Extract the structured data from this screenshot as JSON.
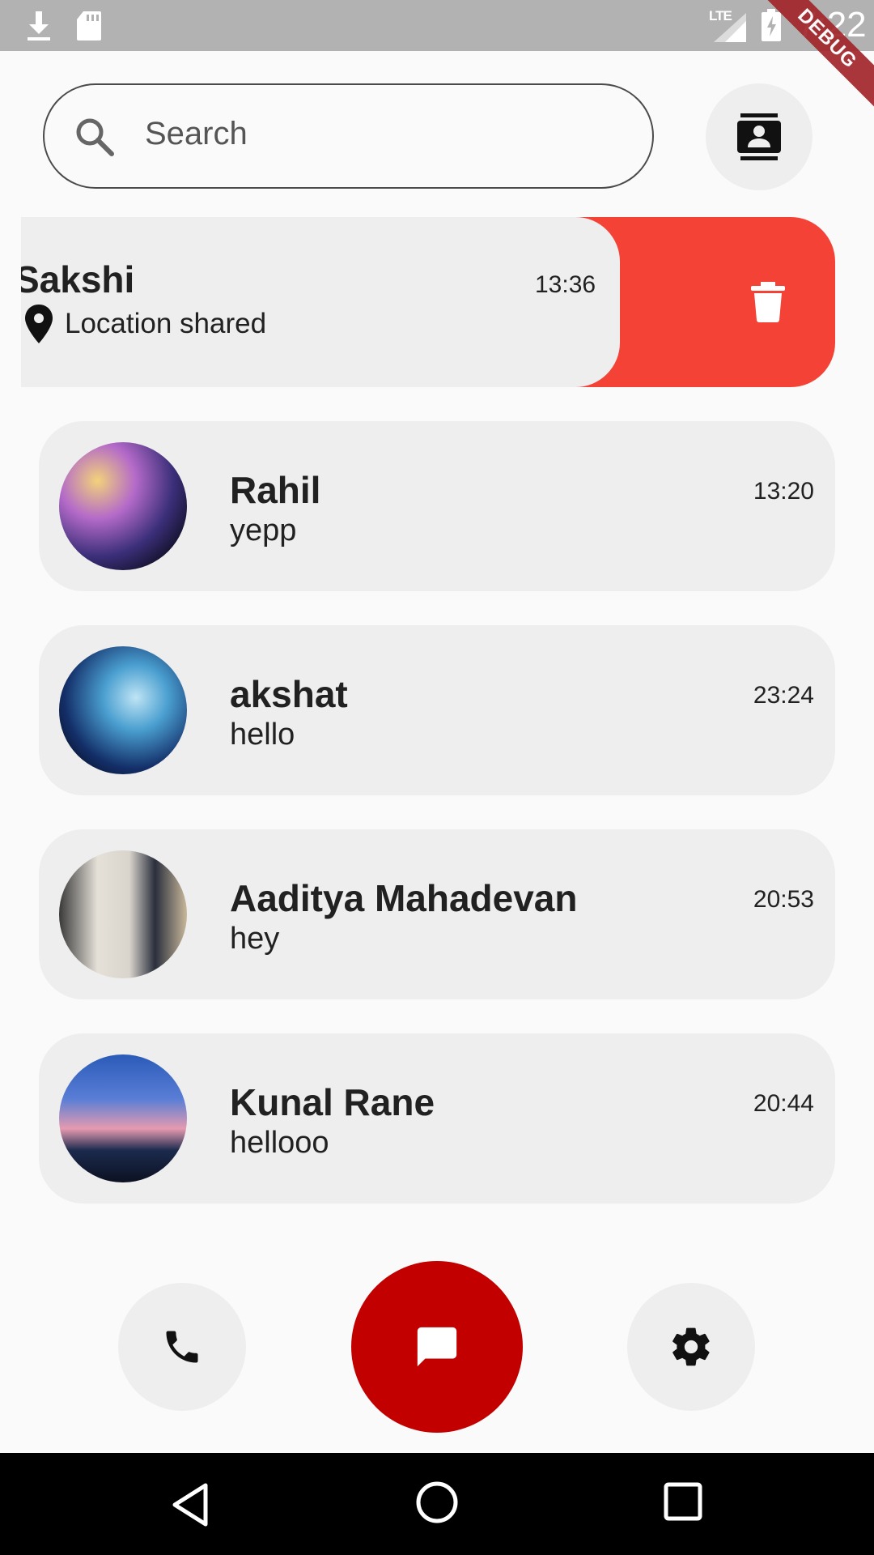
{
  "status_bar": {
    "time": "7:22",
    "network": "LTE",
    "debug_label": "DEBUG"
  },
  "search": {
    "placeholder": "Search"
  },
  "swiped_chat": {
    "name": "Sakshi",
    "time": "13:36",
    "message": "Location shared",
    "message_icon": "location-pin-icon",
    "action_icon": "trash-icon",
    "action_color": "#f44336"
  },
  "chats": [
    {
      "name": "Rahil",
      "message": "yepp",
      "time": "13:20"
    },
    {
      "name": "akshat",
      "message": "hello",
      "time": "23:24"
    },
    {
      "name": "Aaditya Mahadevan",
      "message": "hey",
      "time": "20:53"
    },
    {
      "name": "Kunal Rane",
      "message": "hellooo",
      "time": "20:44"
    }
  ],
  "bottom_nav": {
    "call_icon": "phone-icon",
    "chat_icon": "chat-bubble-icon",
    "settings_icon": "gear-icon",
    "active_color": "#c20000"
  },
  "header": {
    "contacts_icon": "contacts-icon"
  }
}
